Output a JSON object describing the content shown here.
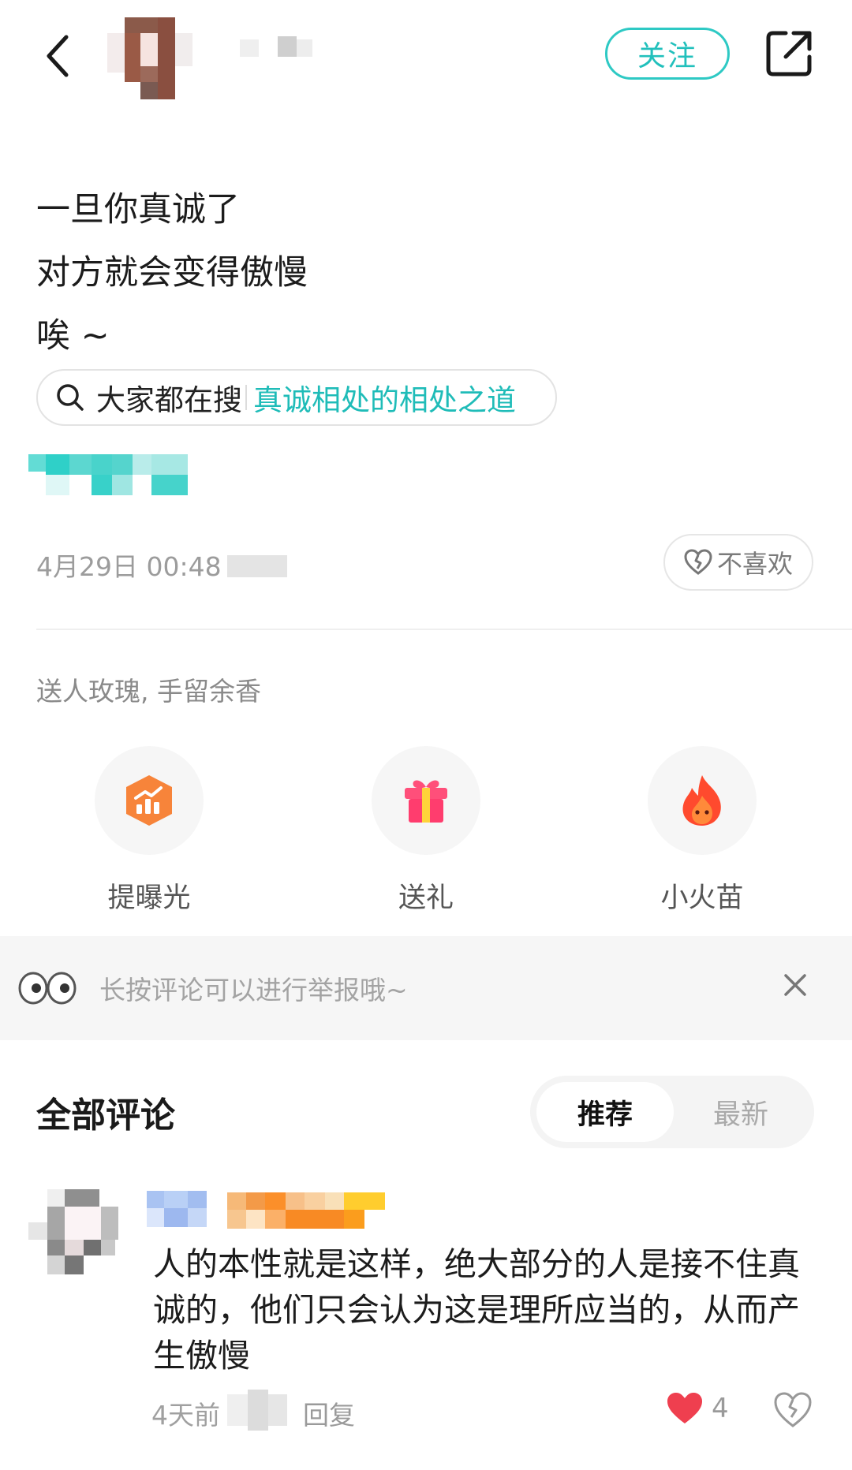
{
  "header": {
    "follow_label": "关注",
    "icons": {
      "back": "chevron-left-icon",
      "share": "share-external-icon"
    }
  },
  "post": {
    "lines": [
      "一旦你真诚了",
      "对方就会变得傲慢",
      "唉 ~"
    ],
    "search_suggestion": {
      "prefix": "大家都在搜",
      "term": "真诚相处的相处之道"
    },
    "timestamp": "4月29日 00:48",
    "dislike_label": "不喜欢"
  },
  "gifts": {
    "caption": "送人玫瑰, 手留余香",
    "actions": [
      {
        "label": "提曝光",
        "icon": "boost-exposure-icon"
      },
      {
        "label": "送礼",
        "icon": "gift-icon"
      },
      {
        "label": "小火苗",
        "icon": "flame-icon"
      }
    ]
  },
  "tip": {
    "text": "长按评论可以进行举报哦~",
    "icons": {
      "lead": "eyes-icon",
      "close": "close-icon"
    }
  },
  "comments": {
    "title": "全部评论",
    "sort": {
      "active": "推荐",
      "inactive": "最新"
    },
    "items": [
      {
        "text": "人的本性就是这样，绝大部分的人是接不住真诚的，他们只会认为这是理所应当的，从而产生傲慢",
        "time": "4天前",
        "reply_label": "回复",
        "likes": "4"
      }
    ]
  },
  "colors": {
    "accent": "#21c0bc",
    "like": "#ef3f4f",
    "tip_bg": "#f6f6f6"
  }
}
